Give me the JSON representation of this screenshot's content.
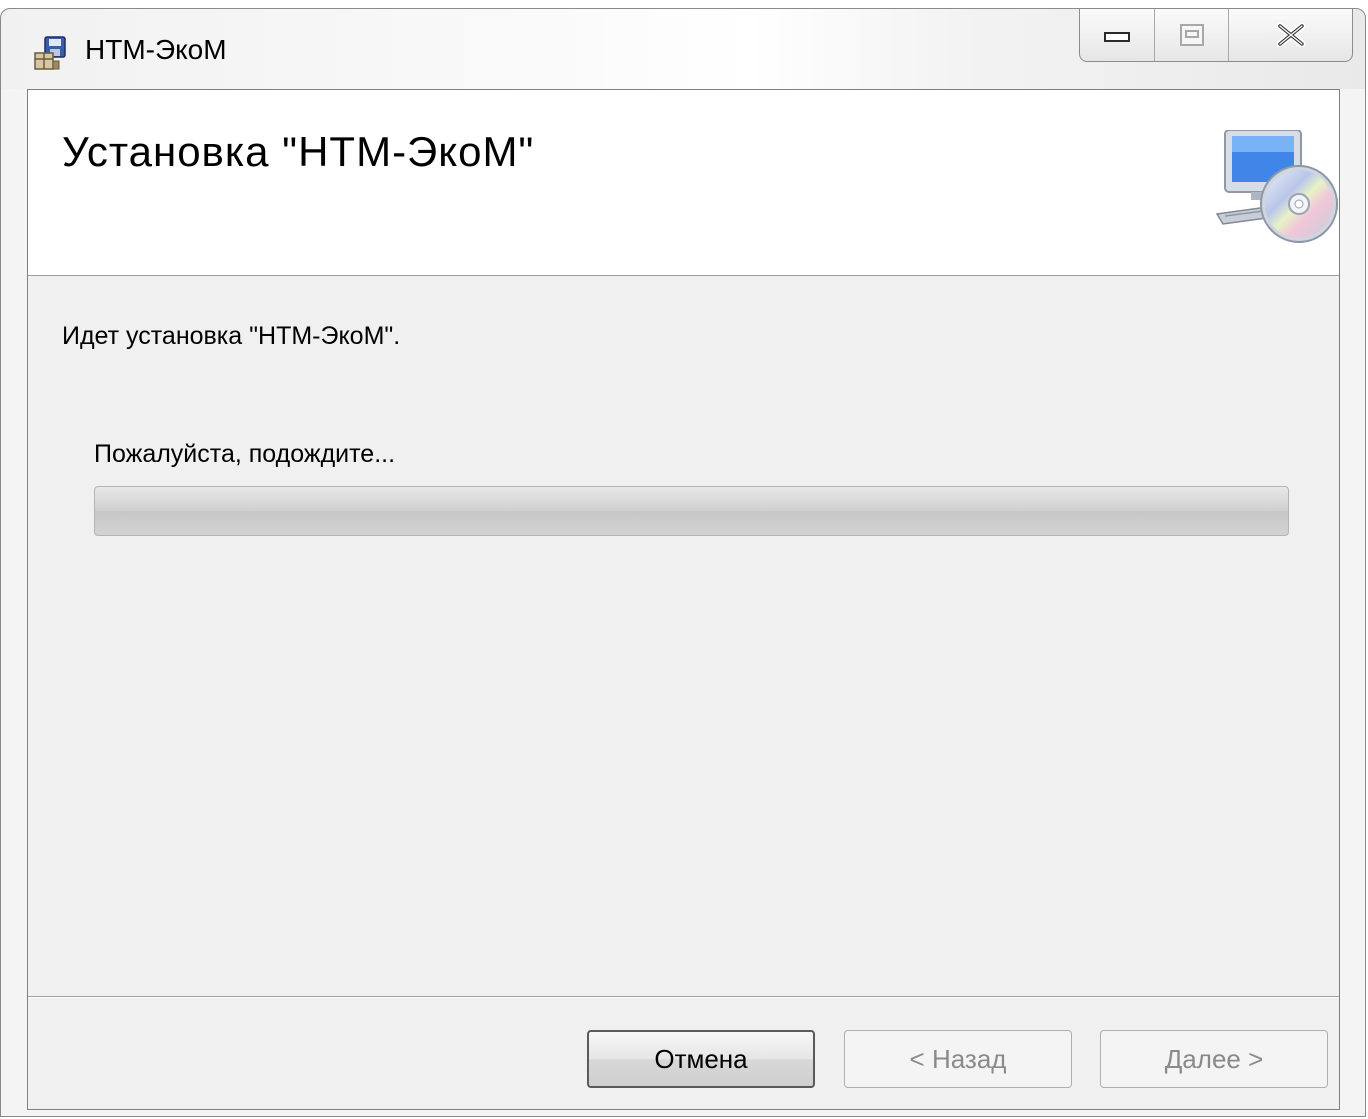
{
  "window": {
    "title": "НТМ-ЭкоМ"
  },
  "caption": {
    "minimize_icon": "minimize-icon",
    "maximize_icon": "maximize-icon",
    "close_icon": "close-icon"
  },
  "banner": {
    "title": "Установка \"НТМ-ЭкоМ\"",
    "icon": "computer-cd-icon"
  },
  "content": {
    "status": "Идет установка \"НТМ-ЭкоМ\".",
    "wait_label": "Пожалуйста, подождите...",
    "progress": 0
  },
  "buttons": {
    "cancel": "Отмена",
    "back": "< Назад",
    "next": "Далее >"
  },
  "colors": {
    "progress_fill": "#37d02c",
    "client_bg": "#f0f0f0",
    "banner_bg": "#ffffff"
  }
}
